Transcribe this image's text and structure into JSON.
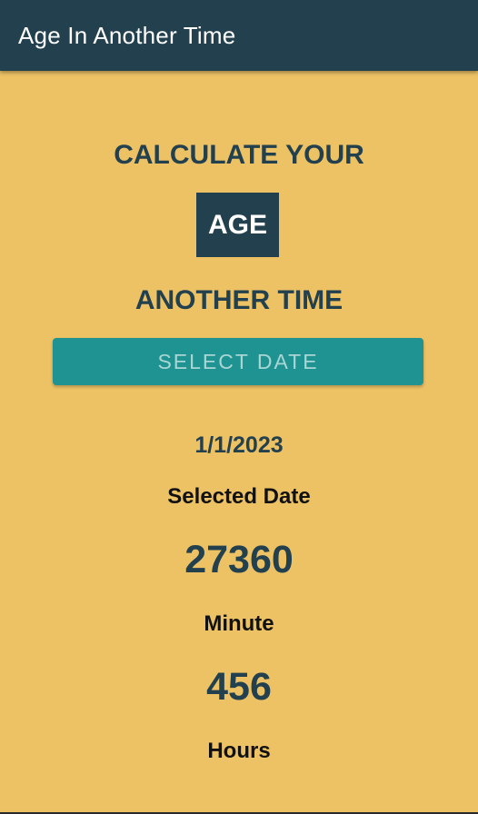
{
  "app_bar": {
    "title": "Age In Another Time"
  },
  "main": {
    "headline_top": "CALCULATE YOUR",
    "age_badge": "AGE",
    "headline_bottom": "ANOTHER TIME",
    "select_button_label": "SELECT DATE",
    "selected_date_value": "1/1/2023",
    "selected_date_label": "Selected Date",
    "minutes_value": "27360",
    "minutes_label": "Minute",
    "hours_value": "456",
    "hours_label": "Hours"
  },
  "colors": {
    "background": "#EDC265",
    "app_bar": "#23404F",
    "accent_button": "#1F9391",
    "primary_text": "#23404F"
  }
}
